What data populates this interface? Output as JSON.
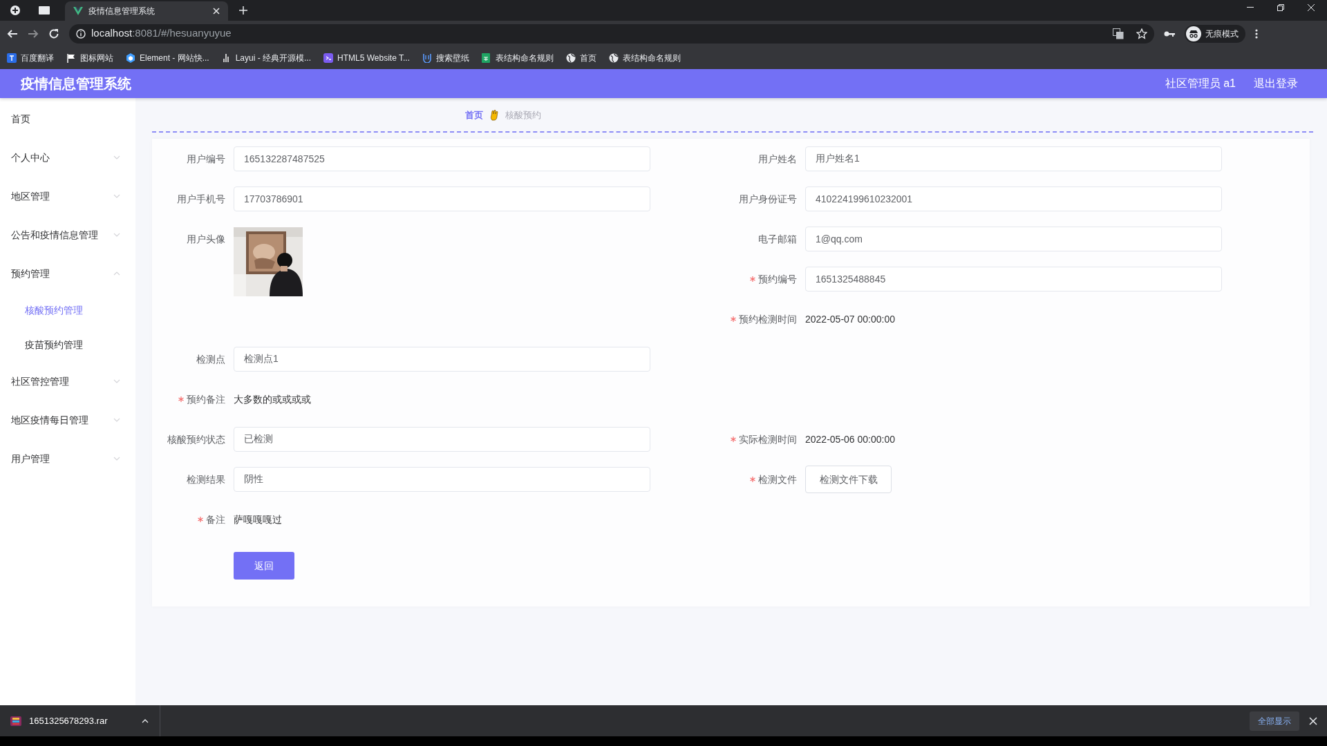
{
  "browser": {
    "tab_title": "疫情信息管理系统",
    "url_host": "localhost",
    "url_rest": ":8081/#/hesuanyuyue",
    "incognito": "无痕模式",
    "bookmarks": [
      {
        "kind": "translate",
        "label": "百度翻译"
      },
      {
        "kind": "flag",
        "label": "图标网站"
      },
      {
        "kind": "hexagon",
        "label": "Element - 网站快..."
      },
      {
        "kind": "ruler",
        "label": "Layui - 经典开源模..."
      },
      {
        "kind": "html",
        "label": "HTML5 Website T..."
      },
      {
        "kind": "wallpaper",
        "label": "搜索壁纸"
      },
      {
        "kind": "sheet",
        "label": "表结构命名规则"
      },
      {
        "kind": "globe",
        "label": "首页"
      },
      {
        "kind": "globe",
        "label": "表结构命名规则"
      }
    ]
  },
  "header": {
    "title": "疫情信息管理系统",
    "user": "社区管理员 a1",
    "logout": "退出登录"
  },
  "sidebar": {
    "items": [
      {
        "label": "首页",
        "has_children": false
      },
      {
        "label": "个人中心",
        "has_children": true,
        "expanded": false
      },
      {
        "label": "地区管理",
        "has_children": true,
        "expanded": false
      },
      {
        "label": "公告和疫情信息管理",
        "has_children": true,
        "expanded": false
      },
      {
        "label": "预约管理",
        "has_children": true,
        "expanded": true,
        "children": [
          {
            "label": "核酸预约管理",
            "selected": true
          },
          {
            "label": "疫苗预约管理",
            "selected": false
          }
        ]
      },
      {
        "label": "社区管控管理",
        "has_children": true,
        "expanded": false
      },
      {
        "label": "地区疫情每日管理",
        "has_children": true,
        "expanded": false
      },
      {
        "label": "用户管理",
        "has_children": true,
        "expanded": false
      }
    ]
  },
  "breadcrumb": [
    {
      "label": "首页",
      "current": false
    },
    {
      "label": "核酸预约",
      "current": true
    }
  ],
  "form": {
    "rows": [
      {
        "left": {
          "kind": "input",
          "label": "用户编号",
          "required": false,
          "value": "165132287487525"
        },
        "right": {
          "kind": "input",
          "label": "用户姓名",
          "required": false,
          "value": "用户姓名1"
        }
      },
      {
        "left": {
          "kind": "input",
          "label": "用户手机号",
          "required": false,
          "value": "17703786901"
        },
        "right": {
          "kind": "input",
          "label": "用户身份证号",
          "required": false,
          "value": "410224199610232001"
        }
      },
      {
        "left": {
          "label": "用户头像",
          "required": false
        },
        "right": {
          "kind": "input",
          "label": "电子邮箱",
          "required": false,
          "value": "1@qq.com"
        }
      },
      {
        "right": {
          "kind": "input",
          "label": "预约编号",
          "required": true,
          "value": "1651325488845"
        }
      },
      {
        "right": {
          "kind": "text",
          "label": "预约检测时间",
          "required": true,
          "value": "2022-05-07 00:00:00"
        }
      },
      {
        "left": {
          "kind": "input",
          "label": "检测点",
          "required": false,
          "value": "检测点1"
        }
      },
      {
        "left": {
          "kind": "text",
          "label": "预约备注",
          "required": true,
          "value": "大多数的或或或或"
        }
      },
      {
        "left": {
          "kind": "input",
          "label": "核酸预约状态",
          "required": false,
          "value": "已检测"
        },
        "right": {
          "kind": "text",
          "label": "实际检测时间",
          "required": true,
          "value": "2022-05-06 00:00:00"
        }
      },
      {
        "left": {
          "kind": "input",
          "label": "检测结果",
          "required": false,
          "value": "阴性"
        },
        "right": {
          "kind": "file",
          "label": "检测文件",
          "required": true,
          "value": "检测文件下载"
        }
      },
      {
        "left": {
          "kind": "text",
          "label": "备注",
          "required": true,
          "value": "萨嘎嘎嘎过"
        }
      }
    ],
    "button": "返回"
  },
  "downloads": {
    "file": "1651325678293.rar",
    "show_all": "全部显示"
  }
}
